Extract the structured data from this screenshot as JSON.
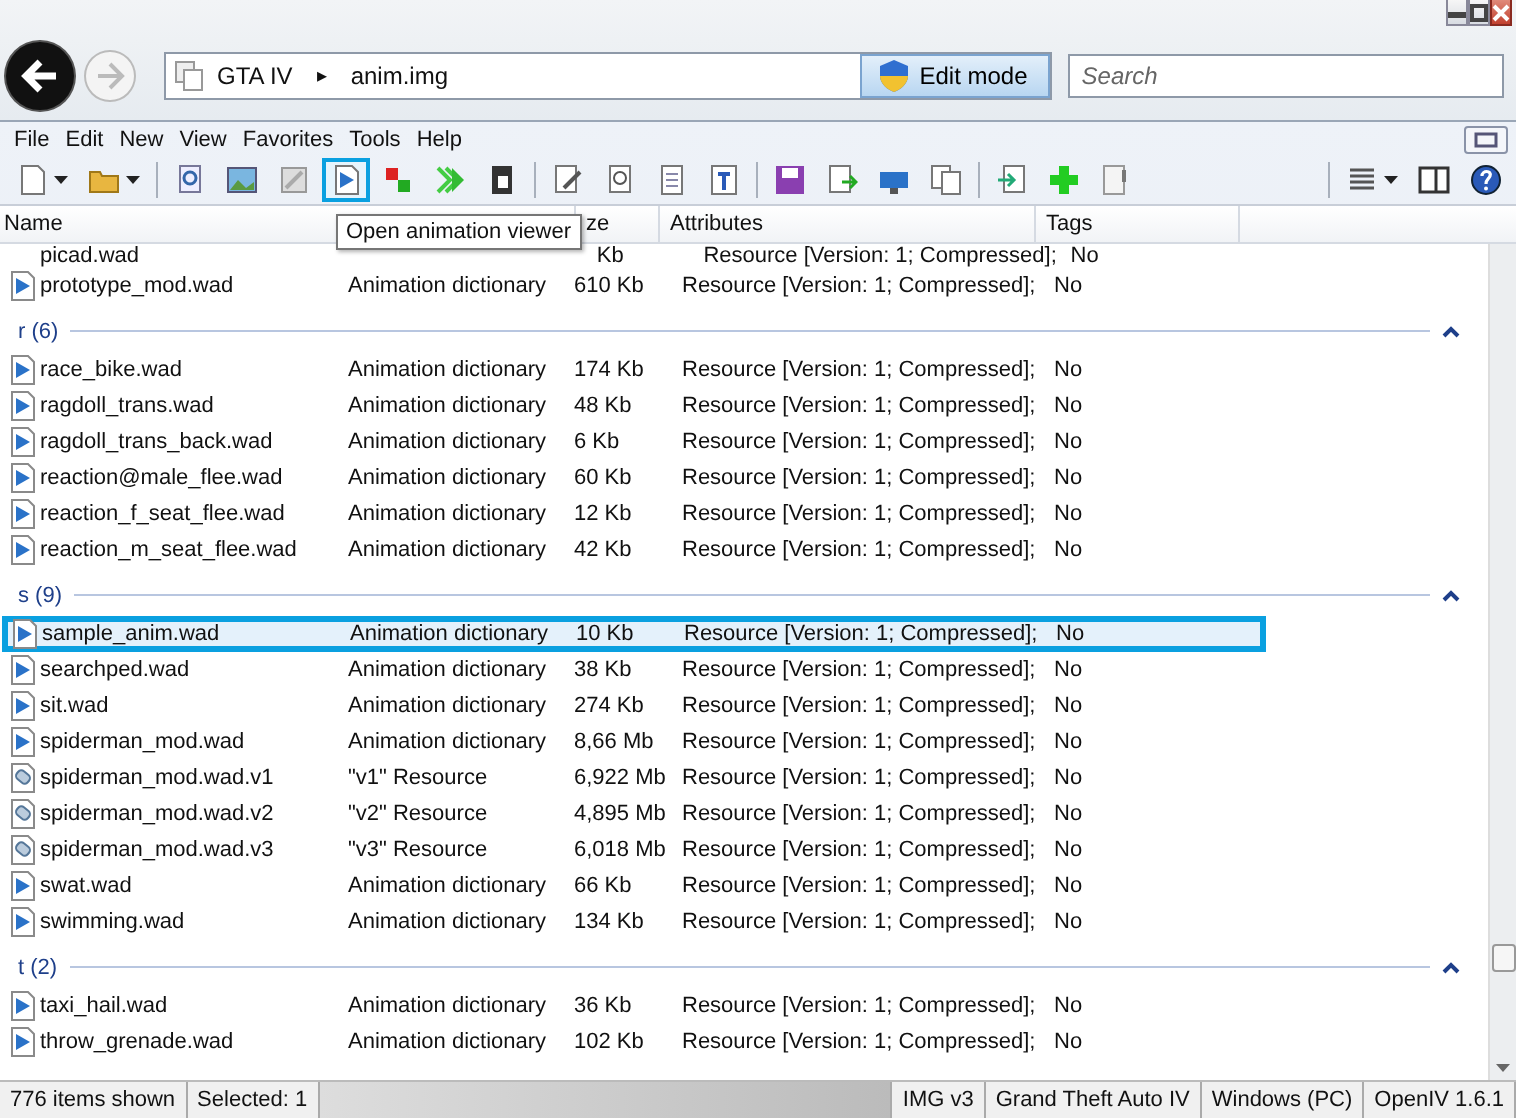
{
  "address": {
    "crumbs": [
      "GTA IV",
      "anim.img"
    ],
    "separator": "▸",
    "edit_mode": "Edit mode",
    "search_placeholder": "Search"
  },
  "menu": [
    "File",
    "Edit",
    "New",
    "View",
    "Favorites",
    "Tools",
    "Help"
  ],
  "toolbar": [
    {
      "kind": "button",
      "dropdown": true,
      "highlighted": false
    },
    {
      "kind": "button",
      "dropdown": true,
      "highlighted": false
    },
    {
      "kind": "separator"
    },
    {
      "kind": "button",
      "highlighted": false
    },
    {
      "kind": "button",
      "highlighted": false
    },
    {
      "kind": "button",
      "highlighted": false
    },
    {
      "kind": "button",
      "highlighted": true
    },
    {
      "kind": "button",
      "highlighted": false
    },
    {
      "kind": "button",
      "highlighted": false
    },
    {
      "kind": "button",
      "highlighted": false
    },
    {
      "kind": "separator"
    },
    {
      "kind": "button",
      "highlighted": false
    },
    {
      "kind": "button",
      "highlighted": false
    },
    {
      "kind": "button",
      "highlighted": false
    },
    {
      "kind": "button",
      "highlighted": false
    },
    {
      "kind": "separator"
    },
    {
      "kind": "button",
      "highlighted": false
    },
    {
      "kind": "button",
      "highlighted": false
    },
    {
      "kind": "button",
      "highlighted": false
    },
    {
      "kind": "button",
      "highlighted": false
    },
    {
      "kind": "separator"
    },
    {
      "kind": "button",
      "highlighted": false
    },
    {
      "kind": "button",
      "highlighted": false
    },
    {
      "kind": "button",
      "highlighted": false
    },
    {
      "kind": "separator"
    },
    {
      "kind": "button",
      "dropdown": true,
      "highlighted": false
    },
    {
      "kind": "button",
      "highlighted": false
    },
    {
      "kind": "button",
      "highlighted": false
    }
  ],
  "tooltip": "Open animation viewer",
  "table": {
    "columns": [
      "Name",
      "ze",
      "Attributes",
      "Tags"
    ],
    "top_row": {
      "name": "picad.wad",
      "size": "Kb",
      "attributes": "Resource [Version: 1; Compressed];",
      "tags": "No"
    },
    "items": [
      {
        "kind": "animation",
        "name": "prototype_mod.wad",
        "file_type": "Animation dictionary",
        "size": "610 Kb",
        "attributes": "Resource [Version: 1; Compressed];",
        "tags": "No",
        "selected": false
      },
      {
        "kind": "group",
        "label": "r (6)",
        "expanded": true
      },
      {
        "kind": "animation",
        "name": "race_bike.wad",
        "file_type": "Animation dictionary",
        "size": "174 Kb",
        "attributes": "Resource [Version: 1; Compressed];",
        "tags": "No",
        "selected": false
      },
      {
        "kind": "animation",
        "name": "ragdoll_trans.wad",
        "file_type": "Animation dictionary",
        "size": "48 Kb",
        "attributes": "Resource [Version: 1; Compressed];",
        "tags": "No",
        "selected": false
      },
      {
        "kind": "animation",
        "name": "ragdoll_trans_back.wad",
        "file_type": "Animation dictionary",
        "size": "6 Kb",
        "attributes": "Resource [Version: 1; Compressed];",
        "tags": "No",
        "selected": false
      },
      {
        "kind": "animation",
        "name": "reaction@male_flee.wad",
        "file_type": "Animation dictionary",
        "size": "60 Kb",
        "attributes": "Resource [Version: 1; Compressed];",
        "tags": "No",
        "selected": false
      },
      {
        "kind": "animation",
        "name": "reaction_f_seat_flee.wad",
        "file_type": "Animation dictionary",
        "size": "12 Kb",
        "attributes": "Resource [Version: 1; Compressed];",
        "tags": "No",
        "selected": false
      },
      {
        "kind": "animation",
        "name": "reaction_m_seat_flee.wad",
        "file_type": "Animation dictionary",
        "size": "42 Kb",
        "attributes": "Resource [Version: 1; Compressed];",
        "tags": "No",
        "selected": false
      },
      {
        "kind": "group",
        "label": "s (9)",
        "expanded": true
      },
      {
        "kind": "animation",
        "name": "sample_anim.wad",
        "file_type": "Animation dictionary",
        "size": "10 Kb",
        "attributes": "Resource [Version: 1; Compressed];",
        "tags": "No",
        "selected": true
      },
      {
        "kind": "animation",
        "name": "searchped.wad",
        "file_type": "Animation dictionary",
        "size": "38 Kb",
        "attributes": "Resource [Version: 1; Compressed];",
        "tags": "No",
        "selected": false
      },
      {
        "kind": "animation",
        "name": "sit.wad",
        "file_type": "Animation dictionary",
        "size": "274 Kb",
        "attributes": "Resource [Version: 1; Compressed];",
        "tags": "No",
        "selected": false
      },
      {
        "kind": "animation",
        "name": "spiderman_mod.wad",
        "file_type": "Animation dictionary",
        "size": "8,66 Mb",
        "attributes": "Resource [Version: 1; Compressed];",
        "tags": "No",
        "selected": false
      },
      {
        "kind": "resource",
        "name": "spiderman_mod.wad.v1",
        "file_type": "\"v1\" Resource",
        "size": "6,922 Mb",
        "attributes": "Resource [Version: 1; Compressed];",
        "tags": "No",
        "selected": false
      },
      {
        "kind": "resource",
        "name": "spiderman_mod.wad.v2",
        "file_type": "\"v2\" Resource",
        "size": "4,895 Mb",
        "attributes": "Resource [Version: 1; Compressed];",
        "tags": "No",
        "selected": false
      },
      {
        "kind": "resource",
        "name": "spiderman_mod.wad.v3",
        "file_type": "\"v3\" Resource",
        "size": "6,018 Mb",
        "attributes": "Resource [Version: 1; Compressed];",
        "tags": "No",
        "selected": false
      },
      {
        "kind": "animation",
        "name": "swat.wad",
        "file_type": "Animation dictionary",
        "size": "66 Kb",
        "attributes": "Resource [Version: 1; Compressed];",
        "tags": "No",
        "selected": false
      },
      {
        "kind": "animation",
        "name": "swimming.wad",
        "file_type": "Animation dictionary",
        "size": "134 Kb",
        "attributes": "Resource [Version: 1; Compressed];",
        "tags": "No",
        "selected": false
      },
      {
        "kind": "group",
        "label": "t (2)",
        "expanded": true
      },
      {
        "kind": "animation",
        "name": "taxi_hail.wad",
        "file_type": "Animation dictionary",
        "size": "36 Kb",
        "attributes": "Resource [Version: 1; Compressed];",
        "tags": "No",
        "selected": false
      },
      {
        "kind": "animation",
        "name": "throw_grenade.wad",
        "file_type": "Animation dictionary",
        "size": "102 Kb",
        "attributes": "Resource [Version: 1; Compressed];",
        "tags": "No",
        "selected": false
      }
    ]
  },
  "status_bar": {
    "left": [
      "776 items shown",
      "Selected: 1"
    ],
    "right": [
      "IMG v3",
      "Grand Theft Auto IV",
      "Windows (PC)",
      "OpenIV 1.6.1"
    ]
  }
}
